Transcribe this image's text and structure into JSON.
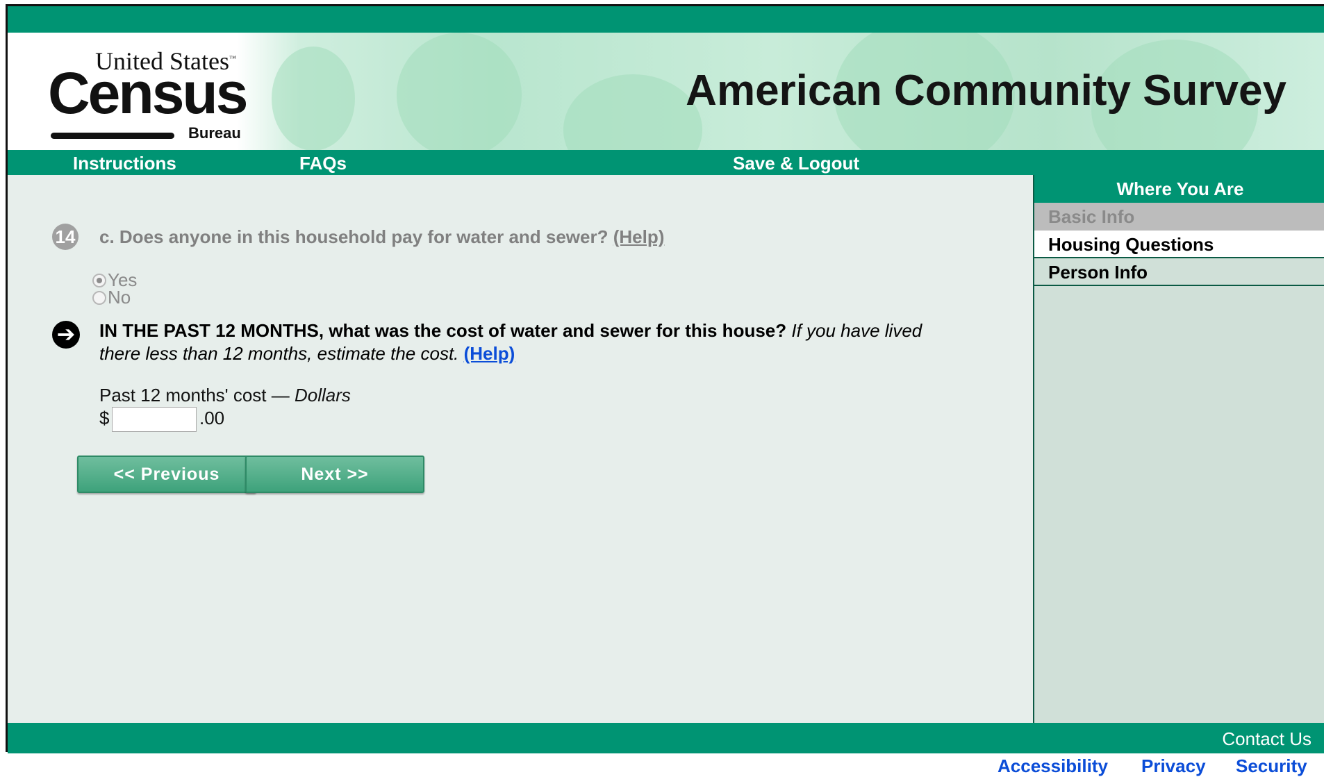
{
  "header": {
    "logo": {
      "united_states": "United States",
      "tm": "™",
      "census": "Census",
      "bureau": "Bureau"
    },
    "title": "American Community Survey"
  },
  "nav": {
    "instructions": "Instructions",
    "faqs": "FAQs",
    "save_logout": "Save & Logout"
  },
  "previous_question": {
    "number": "14",
    "text": "c. Does anyone in this household pay for water and sewer?",
    "help": "(Help)",
    "options": [
      {
        "label": "Yes",
        "selected": true
      },
      {
        "label": "No",
        "selected": false
      }
    ]
  },
  "current_question": {
    "arrow_icon": "arrow-right-icon",
    "caps": "IN THE PAST 12 MONTHS,",
    "text": " what was the cost of water and sewer for this house?",
    "hint": " If you have lived there less than 12 months, estimate the cost. ",
    "help": "(Help)"
  },
  "cost": {
    "label": "Past 12 months' cost — ",
    "label_unit": "Dollars",
    "prefix": "$",
    "value": "",
    "suffix": ".00"
  },
  "buttons": {
    "previous": "<<  Previous",
    "next": "Next  >>"
  },
  "sidebar": {
    "heading": "Where You Are",
    "items": [
      {
        "label": "Basic Info",
        "state": "disabled"
      },
      {
        "label": "Housing Questions",
        "state": "current"
      },
      {
        "label": "Person Info",
        "state": "default"
      }
    ]
  },
  "footer": {
    "contact": "Contact Us",
    "links": [
      "Accessibility",
      "Privacy",
      "Security"
    ]
  },
  "colors": {
    "brand_green": "#009473",
    "link_blue": "#0b4dd8",
    "content_bg": "#e7eeeb",
    "sidebar_bg": "#d0e0d8"
  }
}
